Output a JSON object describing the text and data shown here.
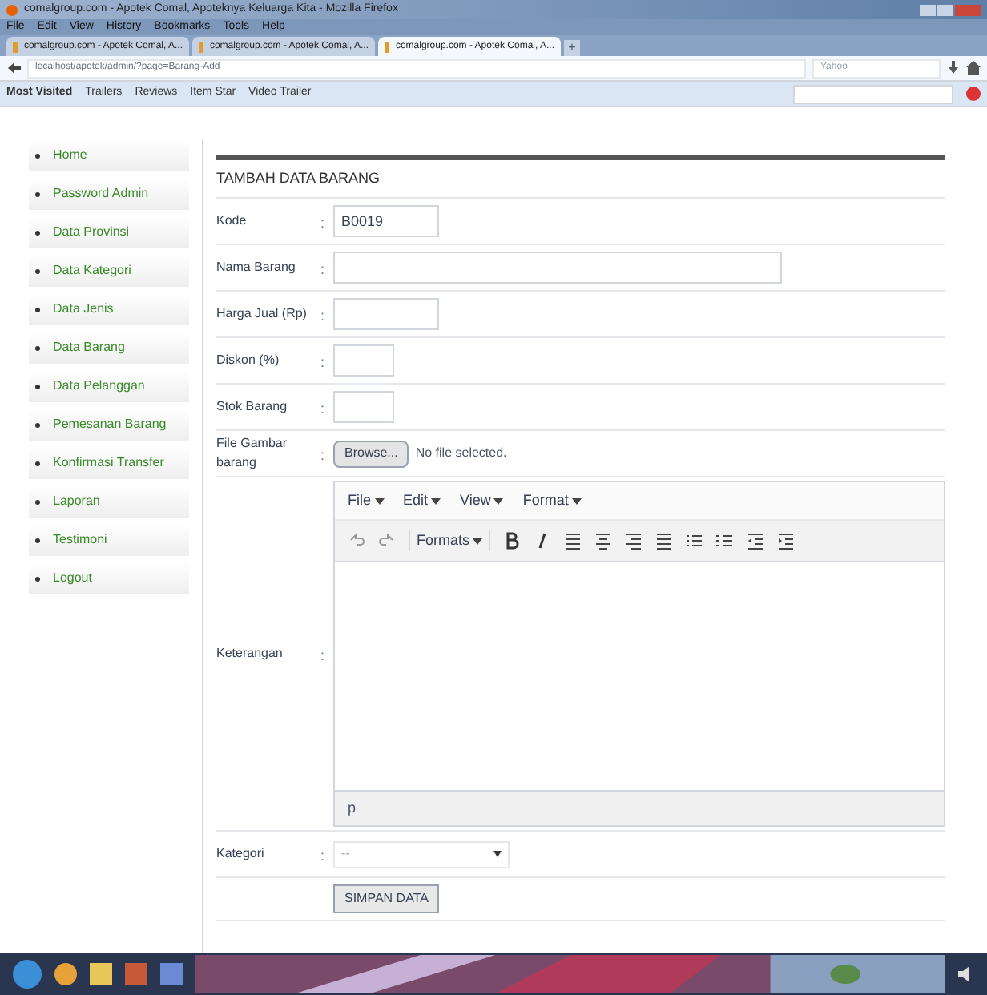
{
  "window": {
    "title": "comalgroup.com - Apotek Comal, Apoteknya Keluarga Kita - Mozilla Firefox"
  },
  "menu": [
    "File",
    "Edit",
    "View",
    "History",
    "Bookmarks",
    "Tools",
    "Help"
  ],
  "tabs": [
    {
      "label": "comalgroup.com - Apotek Comal, A...",
      "selected": false
    },
    {
      "label": "comalgroup.com - Apotek Comal, A...",
      "selected": false
    },
    {
      "label": "comalgroup.com - Apotek Comal, A...",
      "selected": true
    }
  ],
  "new_tab": "+",
  "address": {
    "value": "localhost/apotek/admin/?page=Barang-Add"
  },
  "search": {
    "placeholder": "Yahoo"
  },
  "bookmarks": [
    "Most Visited",
    "Trailers",
    "Reviews",
    "Item Star",
    "Video Trailer"
  ],
  "sidebar": {
    "items": [
      {
        "label": "Home"
      },
      {
        "label": "Password Admin"
      },
      {
        "label": "Data Provinsi"
      },
      {
        "label": "Data Kategori"
      },
      {
        "label": "Data Jenis"
      },
      {
        "label": "Data Barang"
      },
      {
        "label": "Data Pelanggan"
      },
      {
        "label": "Pemesanan Barang"
      },
      {
        "label": "Konfirmasi Transfer"
      },
      {
        "label": "Laporan"
      },
      {
        "label": "Testimoni"
      },
      {
        "label": "Logout"
      }
    ]
  },
  "form": {
    "title": "TAMBAH DATA BARANG",
    "fields": [
      {
        "kind": "text",
        "label": "Kode",
        "separator": ":",
        "value": "B0019"
      },
      {
        "kind": "text",
        "label": "Nama Barang",
        "separator": ":"
      },
      {
        "kind": "text",
        "label": "Harga Jual (Rp)",
        "separator": ":"
      },
      {
        "kind": "text",
        "label": "Diskon (%)",
        "separator": ":"
      },
      {
        "kind": "text",
        "label": "Stok Barang",
        "separator": ":"
      },
      {
        "kind": "file",
        "label": "File Gambar barang",
        "separator": ":",
        "button": "Browse...",
        "status": "No file selected."
      },
      {
        "kind": "editor",
        "label": "Keterangan",
        "separator": ":",
        "menus": [
          "File",
          "Edit",
          "View",
          "Format"
        ],
        "formats": "Formats",
        "path": "p"
      },
      {
        "kind": "select",
        "label": "Kategori",
        "separator": ":",
        "placeholder": "--"
      }
    ],
    "submit": "SIMPAN DATA"
  }
}
